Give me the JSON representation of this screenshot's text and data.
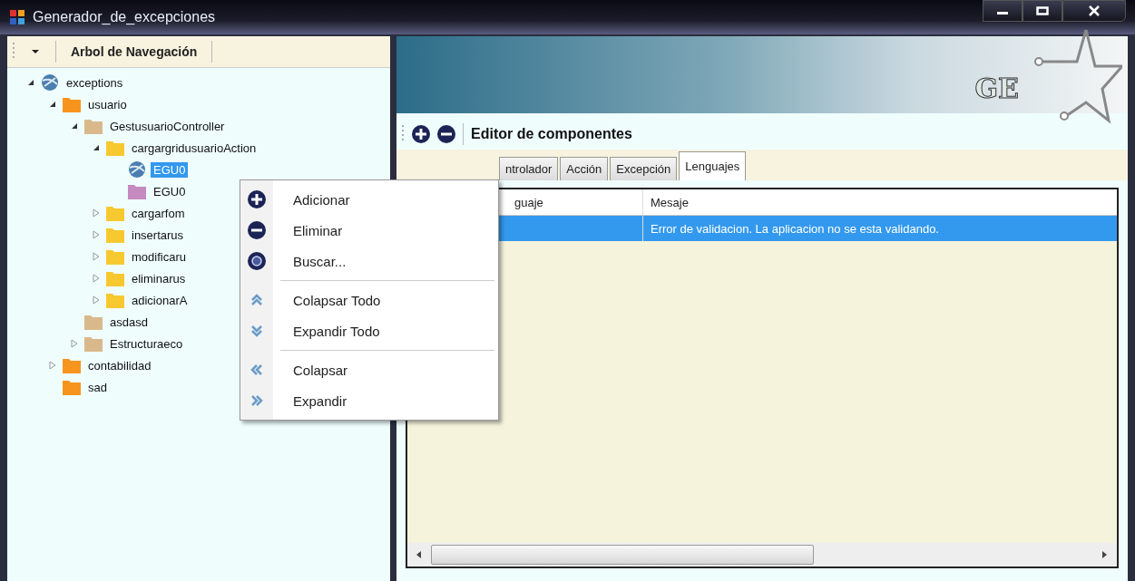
{
  "window": {
    "title": "Generador_de_excepciones"
  },
  "navigation": {
    "title": "Arbol de Navegación",
    "tree": [
      {
        "label": "exceptions",
        "kind": "globe",
        "expanded": true,
        "selected": false,
        "children": [
          {
            "label": "usuario",
            "kind": "module",
            "expanded": true,
            "selected": false,
            "children": [
              {
                "label": "GestusuarioController",
                "kind": "controller",
                "expanded": true,
                "selected": false,
                "children": [
                  {
                    "label": "cargargridusuarioAction",
                    "kind": "action",
                    "expanded": true,
                    "selected": false,
                    "children": [
                      {
                        "label": "EGU0",
                        "kind": "globe",
                        "selected": true
                      },
                      {
                        "label": "EGU0",
                        "kind": "message",
                        "selected": false
                      }
                    ]
                  },
                  {
                    "label": "cargarfom",
                    "kind": "action",
                    "expanded": false,
                    "selected": false
                  },
                  {
                    "label": "insertarus",
                    "kind": "action",
                    "expanded": false,
                    "selected": false
                  },
                  {
                    "label": "modificaru",
                    "kind": "action",
                    "expanded": false,
                    "selected": false
                  },
                  {
                    "label": "eliminarus",
                    "kind": "action",
                    "expanded": false,
                    "selected": false
                  },
                  {
                    "label": "adicionarA",
                    "kind": "action",
                    "expanded": false,
                    "selected": false
                  }
                ]
              },
              {
                "label": "asdasd",
                "kind": "controller",
                "selected": false
              },
              {
                "label": "Estructuraeco",
                "kind": "controller",
                "expanded": false,
                "selected": false
              }
            ]
          },
          {
            "label": "contabilidad",
            "kind": "module",
            "expanded": false,
            "selected": false
          },
          {
            "label": "sad",
            "kind": "module",
            "selected": false
          }
        ]
      }
    ]
  },
  "banner": {
    "logo_text": "GE"
  },
  "editor": {
    "title": "Editor de componentes",
    "tabs": [
      {
        "label": "ntrolador",
        "selected": false
      },
      {
        "label": "Acción",
        "selected": false
      },
      {
        "label": "Excepción",
        "selected": false
      },
      {
        "label": "Lenguajes",
        "selected": true
      }
    ],
    "table": {
      "columns": [
        "guaje",
        "Mesaje"
      ],
      "rows": [
        {
          "message": "Error de validacion. La aplicacion no se esta validando.",
          "selected": true
        }
      ]
    }
  },
  "context_menu": {
    "groups": [
      [
        {
          "label": "Adicionar",
          "kind": "add"
        },
        {
          "label": "Eliminar",
          "kind": "remove"
        },
        {
          "label": "Buscar...",
          "kind": "search"
        }
      ],
      [
        {
          "label": "Colapsar Todo",
          "kind": "collapse-all"
        },
        {
          "label": "Expandir Todo",
          "kind": "expand-all"
        }
      ],
      [
        {
          "label": "Colapsar",
          "kind": "collapse"
        },
        {
          "label": "Expandir",
          "kind": "expand"
        }
      ]
    ]
  }
}
